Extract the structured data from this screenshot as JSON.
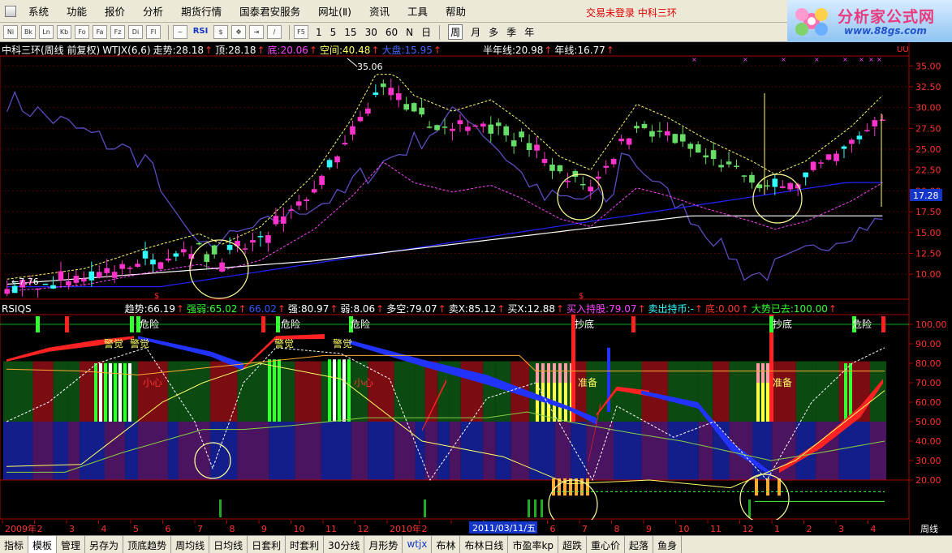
{
  "menu": {
    "items": [
      "系统",
      "功能",
      "报价",
      "分析",
      "期货行情",
      "国泰君安服务",
      "网址(Ⅱ)",
      "资讯",
      "工具",
      "帮助"
    ],
    "right_text": "交易未登录  中科三环"
  },
  "logo": {
    "title": "分析家公式网",
    "url": "www.88gs.com"
  },
  "toolbar": {
    "buttons": [
      "Ni",
      "Bk",
      "Ln",
      "Kb",
      "Fo",
      "Fa",
      "Fz",
      "Di",
      "Fl"
    ],
    "rsi_label": "RSI",
    "f5_label": "F5",
    "periods": [
      "1",
      "5",
      "15",
      "30",
      "60",
      "N",
      "日",
      "周",
      "月",
      "多",
      "季",
      "年"
    ],
    "active_period": "周"
  },
  "price_panel": {
    "title": "中科三环(周线 前复权)",
    "indicator": "WTJX(6,6)",
    "fields": [
      {
        "label": "走势:",
        "value": "28.18",
        "color": "#ffffff"
      },
      {
        "label": "顶:",
        "value": "28.18",
        "color": "#ffffff"
      },
      {
        "label": "底:",
        "value": "20.06",
        "color": "#ff44ff"
      },
      {
        "label": "空间:",
        "value": "40.48",
        "color": "#ffff66"
      },
      {
        "label": "大盘:",
        "value": "15.95",
        "color": "#4466ff"
      },
      {
        "label": "半年线:",
        "value": "20.98",
        "color": "#ffffff"
      },
      {
        "label": "年线:",
        "value": "16.77",
        "color": "#ffffff"
      }
    ],
    "price_axis": [
      "35.00",
      "32.50",
      "30.00",
      "27.50",
      "25.00",
      "22.50",
      "20.00",
      "17.50",
      "15.00",
      "12.50",
      "10.00"
    ],
    "current_price_tag": "17.28",
    "high_label": "35.06",
    "low_label": "7.76",
    "corner_label": "UU"
  },
  "indicator_panel": {
    "name": "RSIQS",
    "fields": [
      {
        "label": "趋势:",
        "value": "66.19",
        "color": "#ffffff"
      },
      {
        "label": "强弱:",
        "value": "65.02",
        "color": "#33ff33"
      },
      {
        "label": "",
        "value": "66.02",
        "color": "#3355ff"
      },
      {
        "label": "强:",
        "value": "80.97",
        "color": "#ffffff"
      },
      {
        "label": "弱:",
        "value": "8.06",
        "color": "#ffffff"
      },
      {
        "label": "多空:",
        "value": "79.07",
        "color": "#ffffff"
      },
      {
        "label": "卖X:",
        "value": "85.12",
        "color": "#ffffff"
      },
      {
        "label": "买X:",
        "value": "12.88",
        "color": "#ffffff"
      },
      {
        "label": "买入持股:",
        "value": "79.07",
        "color": "#ff44ff"
      },
      {
        "label": "卖出持币:",
        "value": "-",
        "color": "#33ffff"
      },
      {
        "label": "底:",
        "value": "0.00",
        "color": "#ff3333"
      },
      {
        "label": "大势已去:",
        "value": "100.00",
        "color": "#33ff33"
      }
    ],
    "axis": [
      "100.00",
      "90.00",
      "80.00",
      "70.00",
      "60.00",
      "50.00",
      "40.00",
      "30.00",
      "20.00"
    ],
    "annotations": [
      {
        "text": "危险",
        "color": "#ffffff"
      },
      {
        "text": "危险",
        "color": "#ffffff"
      },
      {
        "text": "危险",
        "color": "#ffffff"
      },
      {
        "text": "抄底",
        "color": "#ffffff"
      },
      {
        "text": "抄底",
        "color": "#ffffff"
      },
      {
        "text": "危险",
        "color": "#ffffff"
      },
      {
        "text": "警觉",
        "color": "#ffff66"
      },
      {
        "text": "警觉",
        "color": "#ffff66"
      },
      {
        "text": "警觉",
        "color": "#ffff66"
      },
      {
        "text": "警觉",
        "color": "#ffff66"
      },
      {
        "text": "小心",
        "color": "#ff3333"
      },
      {
        "text": "小心",
        "color": "#ff3333"
      },
      {
        "text": "准备",
        "color": "#ffff66"
      },
      {
        "text": "准备",
        "color": "#ffff66"
      }
    ]
  },
  "time_axis": {
    "labels": [
      "2009年",
      "2",
      "3",
      "4",
      "5",
      "6",
      "7",
      "8",
      "9",
      "10",
      "11",
      "12",
      "2010年",
      "2",
      "3",
      "4",
      "5",
      "6",
      "7",
      "8",
      "9",
      "10",
      "11",
      "12",
      "1",
      "2",
      "3",
      "4"
    ],
    "cursor_date": "2011/03/11/五",
    "period_label": "周线"
  },
  "bottom_tabs": {
    "items": [
      "指标",
      "模板",
      "管理",
      "另存为",
      "顶底趋势",
      "周均线",
      "日均线",
      "日套利",
      "时套利",
      "30分线",
      "月形势",
      "wtjx",
      "布林",
      "布林日线",
      "市盈率kp",
      "超跌",
      "重心价",
      "起落",
      "鱼身"
    ],
    "active": "模板"
  }
}
